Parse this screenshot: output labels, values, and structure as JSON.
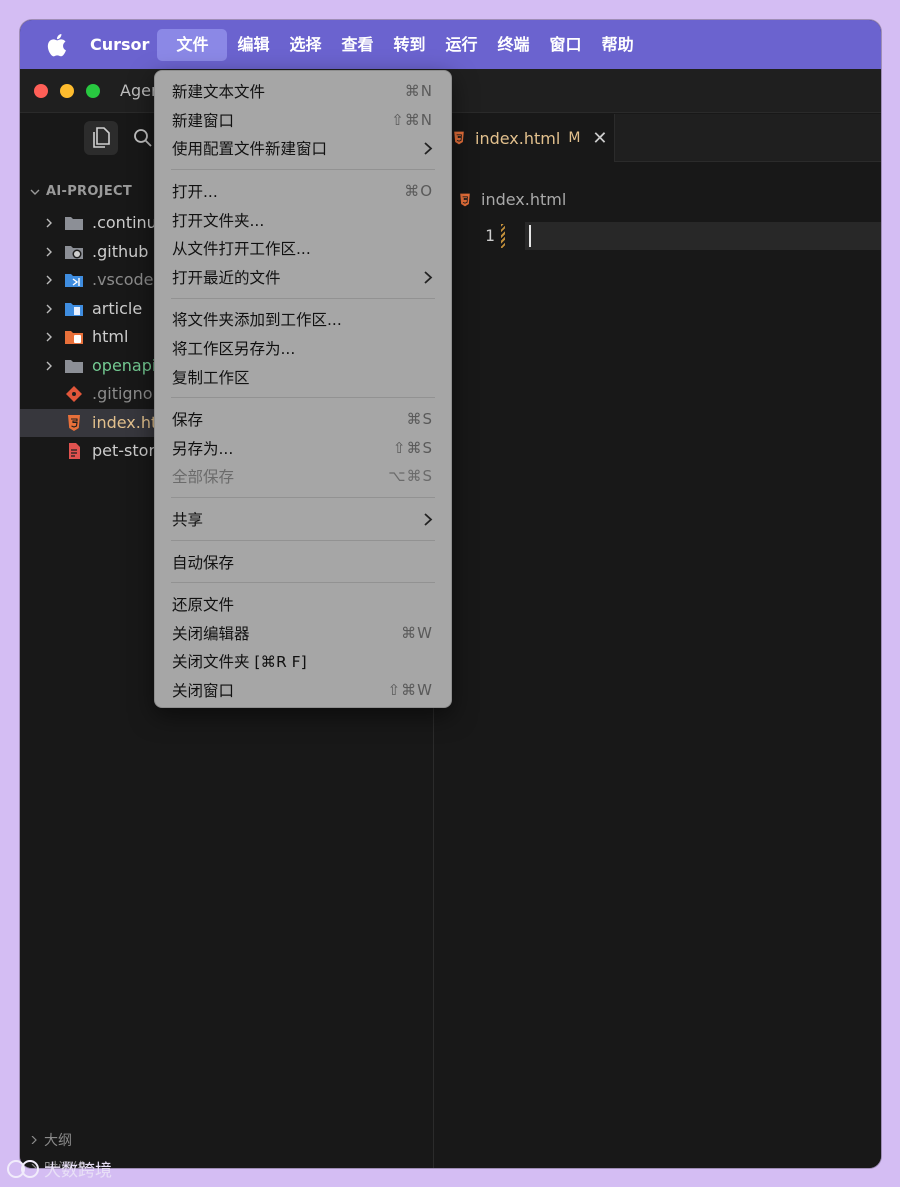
{
  "menubar": {
    "app_name": "Cursor",
    "items": [
      "文件",
      "编辑",
      "选择",
      "查看",
      "转到",
      "运行",
      "终端",
      "窗口",
      "帮助"
    ]
  },
  "window": {
    "title": "Agen"
  },
  "sidebar": {
    "explorer_title": "AI-PROJECT",
    "tree": [
      {
        "name": ".continu",
        "folder": true
      },
      {
        "name": ".github",
        "folder": true
      },
      {
        "name": ".vscode",
        "folder": true
      },
      {
        "name": "article",
        "folder": true
      },
      {
        "name": "html",
        "folder": true
      },
      {
        "name": "openapi",
        "folder": true
      },
      {
        "name": ".gitignor",
        "folder": false
      },
      {
        "name": "index.ht",
        "folder": false
      },
      {
        "name": "pet-stor",
        "folder": false
      }
    ],
    "bottom": [
      "大纲",
      "时间线"
    ]
  },
  "editor": {
    "tab_label": "index.html",
    "tab_modified": "M",
    "tab_close": "✕",
    "breadcrumb": "index.html",
    "line_number": "1"
  },
  "menu": {
    "new_text_file": "新建文本文件",
    "new_text_file_sc": "⌘N",
    "new_window": "新建窗口",
    "new_window_sc": "⇧⌘N",
    "new_window_profile": "使用配置文件新建窗口",
    "open": "打开...",
    "open_sc": "⌘O",
    "open_folder": "打开文件夹...",
    "open_workspace": "从文件打开工作区...",
    "open_recent": "打开最近的文件",
    "add_folder": "将文件夹添加到工作区...",
    "save_workspace_as": "将工作区另存为...",
    "duplicate_workspace": "复制工作区",
    "save": "保存",
    "save_sc": "⌘S",
    "save_as": "另存为...",
    "save_as_sc": "⇧⌘S",
    "save_all": "全部保存",
    "save_all_sc": "⌥⌘S",
    "share": "共享",
    "auto_save": "自动保存",
    "revert_file": "还原文件",
    "close_editor": "关闭编辑器",
    "close_editor_sc": "⌘W",
    "close_folder": "关闭文件夹 [⌘R F]",
    "close_window": "关闭窗口",
    "close_window_sc": "⇧⌘W"
  },
  "watermark": "大数跨境"
}
